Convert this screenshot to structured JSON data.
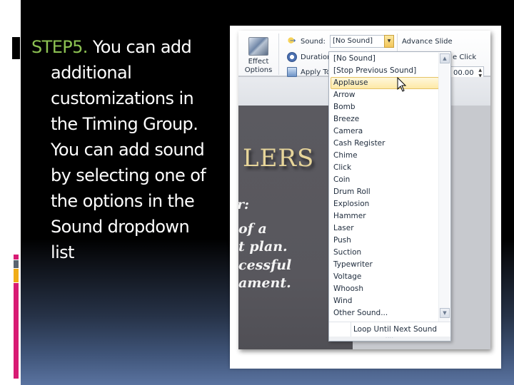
{
  "slide": {
    "step_label": "STEP5.",
    "text_first_line": "You can add",
    "text_lines": [
      "additional",
      "customizations in",
      "the Timing Group.",
      "You can add sound",
      "by selecting one of",
      "the options in the",
      "Sound dropdown",
      "list"
    ],
    "accent_colors": {
      "step_green": "#8cc152",
      "stripe_pink": "#d81b74",
      "stripe_gray": "#5a6470",
      "stripe_orange": "#f0ad18"
    }
  },
  "ribbon": {
    "effect_options_label_1": "Effect",
    "effect_options_label_2": "Options",
    "sound_label": "Sound:",
    "sound_value": "[No Sound]",
    "duration_label": "Duration",
    "apply_label": "Apply To",
    "advance_slide_label": "Advance Slide",
    "on_click_label": "e Click",
    "time_value": "00.00"
  },
  "slide_preview": {
    "title_fragment": "LERS",
    "lines": [
      "r:",
      "of a",
      "t plan.",
      "cessful",
      "ament."
    ]
  },
  "dropdown": {
    "hovered_item": "Applause",
    "items": [
      "[No Sound]",
      "[Stop Previous Sound]",
      "Applause",
      "Arrow",
      "Bomb",
      "Breeze",
      "Camera",
      "Cash Register",
      "Chime",
      "Click",
      "Coin",
      "Drum Roll",
      "Explosion",
      "Hammer",
      "Laser",
      "Push",
      "Suction",
      "Typewriter",
      "Voltage",
      "Whoosh",
      "Wind",
      "Other Sound..."
    ],
    "loop_label": "Loop Until Next Sound",
    "grip": "····"
  }
}
